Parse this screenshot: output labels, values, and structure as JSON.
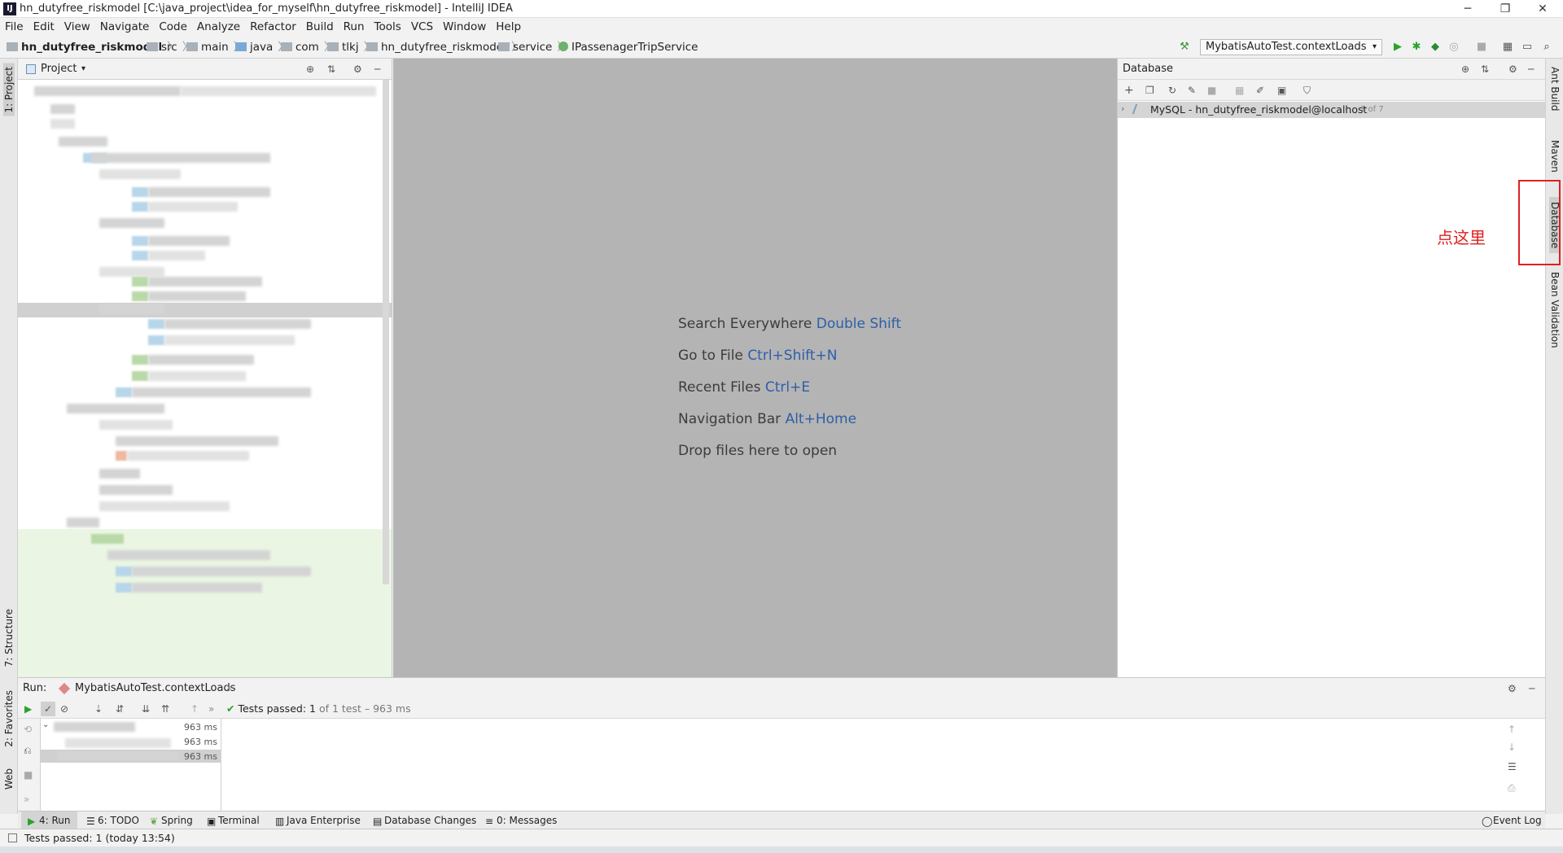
{
  "window": {
    "title": "hn_dutyfree_riskmodel [C:\\java_project\\idea_for_myself\\hn_dutyfree_riskmodel] - IntelliJ IDEA",
    "app_icon": "IJ",
    "minimize": "─",
    "maximize": "❐",
    "close": "✕"
  },
  "menu": [
    "File",
    "Edit",
    "View",
    "Navigate",
    "Code",
    "Analyze",
    "Refactor",
    "Build",
    "Run",
    "Tools",
    "VCS",
    "Window",
    "Help"
  ],
  "breadcrumb": [
    {
      "label": "hn_dutyfree_riskmodel",
      "bold": true
    },
    {
      "label": "src"
    },
    {
      "label": "main"
    },
    {
      "label": "java"
    },
    {
      "label": "com"
    },
    {
      "label": "tlkj"
    },
    {
      "label": "hn_dutyfree_riskmodel"
    },
    {
      "label": "service"
    },
    {
      "label": "IPassenagerTripService"
    }
  ],
  "run_config": "MybatisAutoTest.contextLoads",
  "left_stripe": {
    "project": "1: Project",
    "structure": "7: Structure",
    "favorites": "2: Favorites",
    "web": "Web"
  },
  "project_panel": {
    "title": "Project"
  },
  "editor_hints": [
    {
      "text": "Search Everywhere",
      "key": "Double Shift"
    },
    {
      "text": "Go to File",
      "key": "Ctrl+Shift+N"
    },
    {
      "text": "Recent Files",
      "key": "Ctrl+E"
    },
    {
      "text": "Navigation Bar",
      "key": "Alt+Home"
    },
    {
      "text": "Drop files here to open",
      "key": ""
    }
  ],
  "database": {
    "title": "Database",
    "datasource": "MySQL - hn_dutyfree_riskmodel@localhost",
    "count": "1 of 7"
  },
  "right_stripe": {
    "ant": "Ant Build",
    "maven": "Maven",
    "database": "Database",
    "bean": "Bean Validation"
  },
  "annotation": "点这里",
  "run_panel": {
    "label": "Run:",
    "tab": "MybatisAutoTest.contextLoads",
    "tests_passed_label": "Tests passed:",
    "tests_passed_count": "1",
    "tests_detail": "of 1 test – 963 ms",
    "times": [
      "963 ms",
      "963 ms",
      "963 ms"
    ]
  },
  "bottom_tabs": [
    "4: Run",
    "6: TODO",
    "Spring",
    "Terminal",
    "Java Enterprise",
    "Database Changes",
    "0: Messages"
  ],
  "event_log": "Event Log",
  "status": "Tests passed: 1 (today 13:54)",
  "colors": {
    "accent": "#2d5fa8",
    "annotation": "#e02020",
    "editor_bg": "#b4b4b4",
    "run_green": "#2aa22a"
  }
}
